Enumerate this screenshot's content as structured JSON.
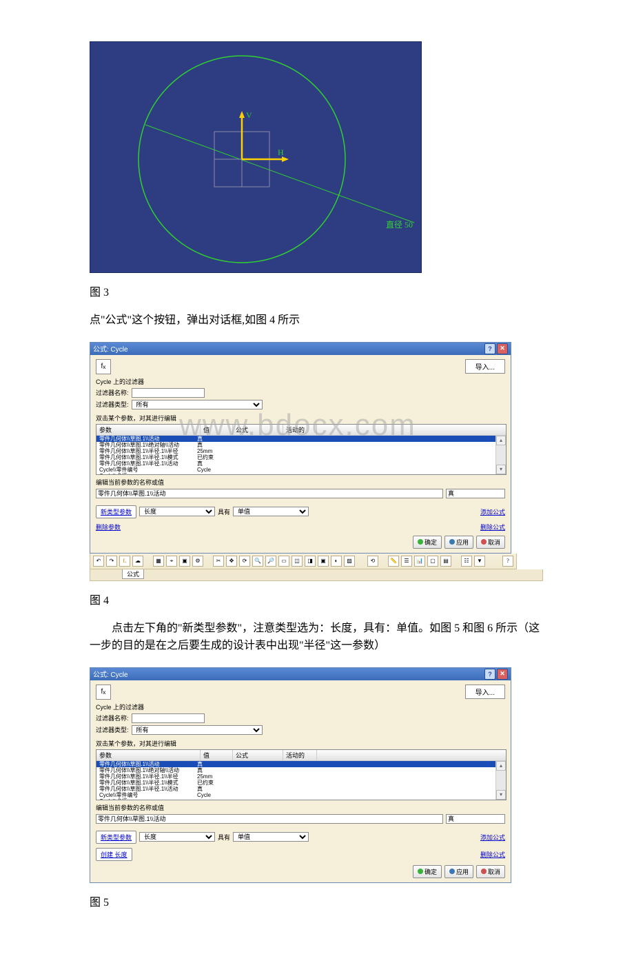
{
  "figure3": {
    "caption": "图 3",
    "diameter_label": "直径 50",
    "axis_v": "V",
    "axis_h": "H"
  },
  "text_after_fig3": "点\"公式\"这个按钮，弹出对话框,如图 4 所示",
  "dialog4": {
    "title": "公式: Cycle",
    "import": "导入...",
    "filter_section": "Cycle 上的过滤器",
    "filter_name_label": "过滤器名称:",
    "filter_name_value": "",
    "filter_type_label": "过滤器类型:",
    "filter_type_value": "所有",
    "instruction": "双击某个参数，对其进行编辑",
    "headers": {
      "c1": "参数",
      "c2": "值",
      "c3": "公式",
      "c4": "活动的"
    },
    "rows": [
      {
        "c1": "零件几何体\\\\草图.1\\\\活动",
        "c2": "真"
      },
      {
        "c1": "零件几何体\\\\草图.1\\\\绝对轴\\\\活动",
        "c2": "真"
      },
      {
        "c1": "零件几何体\\\\草图.1\\\\半径.1\\\\半径",
        "c2": "25mm"
      },
      {
        "c1": "零件几何体\\\\草图.1\\\\半径.1\\\\模式",
        "c2": "已约束"
      },
      {
        "c1": "零件几何体\\\\草图.1\\\\半径.1\\\\活动",
        "c2": "真"
      },
      {
        "c1": "Cycle\\\\零件编号",
        "c2": "Cycle"
      },
      {
        "c1": "Cycle\\\\术语",
        "c2": ""
      }
    ],
    "edit_label": "编辑当前参数的名称或值",
    "current_name": "零件几何体\\\\草图.1\\\\活动",
    "current_value": "真",
    "new_param_btn": "新类型参数",
    "type_value": "长度",
    "with_label": "具有",
    "with_value": "单值",
    "add_formula": "添加公式",
    "delete_param": "删除参数",
    "delete_formula": "删除公式",
    "ok": "确定",
    "apply": "应用",
    "cancel": "取消",
    "toolbar_tab": "公式"
  },
  "figure4_caption": "图 4",
  "text_after_fig4": "点击左下角的\"新类型参数\"，注意类型选为：长度，具有：单值。如图 5 和图 6 所示（这一步的目的是在之后要生成的设计表中出现\"半径\"这一参数）",
  "dialog5": {
    "title": "公式: Cycle",
    "import": "导入...",
    "filter_section": "Cycle 上的过滤器",
    "filter_name_label": "过滤器名称:",
    "filter_type_label": "过滤器类型:",
    "filter_type_value": "所有",
    "instruction": "双击某个参数，对其进行编辑",
    "headers": {
      "c1": "参数",
      "c2": "值",
      "c3": "公式",
      "c4": "活动的"
    },
    "rows": [
      {
        "c1": "零件几何体\\\\草图.1\\\\活动",
        "c2": "真"
      },
      {
        "c1": "零件几何体\\\\草图.1\\\\绝对轴\\\\活动",
        "c2": "真"
      },
      {
        "c1": "零件几何体\\\\草图.1\\\\半径.1\\\\半径",
        "c2": "25mm"
      },
      {
        "c1": "零件几何体\\\\草图.1\\\\半径.1\\\\模式",
        "c2": "已约束"
      },
      {
        "c1": "零件几何体\\\\草图.1\\\\半径.1\\\\活动",
        "c2": "真"
      },
      {
        "c1": "Cycle\\\\零件编号",
        "c2": "Cycle"
      },
      {
        "c1": "Cycle\\\\术语",
        "c2": ""
      }
    ],
    "edit_label": "编辑当前参数的名称或值",
    "current_name": "零件几何体\\\\草图.1\\\\活动",
    "current_value": "真",
    "new_param_btn": "新类型参数",
    "type_value": "长度",
    "with_label": "具有",
    "with_value": "单值",
    "add_formula": "添加公式",
    "create_length": "创建 长度",
    "delete_formula": "删除公式",
    "ok": "确定",
    "apply": "应用",
    "cancel": "取消"
  },
  "figure5_caption": "图 5",
  "watermark": "www.bdocx.com"
}
